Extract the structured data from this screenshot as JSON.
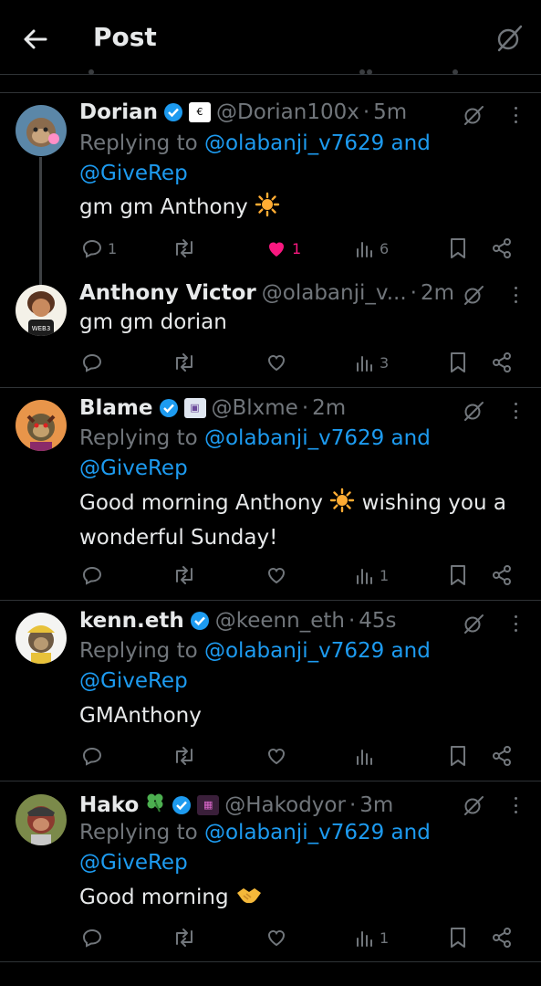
{
  "header": {
    "title": "Post"
  },
  "posts": [
    {
      "name": "Dorian",
      "handle": "@Dorian100x",
      "time": "5m",
      "reply_prefix": "Replying to",
      "reply_mention": "@olabanji_v7629 and",
      "reply_mention2": "@GiveRep",
      "text": "gm gm Anthony",
      "emoji": "☀️",
      "replies": "1",
      "likes": "1",
      "views": "6",
      "liked": true
    },
    {
      "name": "Anthony Victor",
      "handle": "@olabanji_v...",
      "time": "2m",
      "text": "gm gm dorian",
      "views": "3"
    },
    {
      "name": "Blame",
      "handle": "@Blxme",
      "time": "2m",
      "reply_prefix": "Replying to",
      "reply_mention": "@olabanji_v7629 and",
      "reply_mention2": "@GiveRep",
      "text_line1": "Good morning Anthony",
      "text_emoji": "☀️",
      "text_line1b": "wishing you a",
      "text_line2": "wonderful Sunday!",
      "views": "1"
    },
    {
      "name": "kenn.eth",
      "handle": "@keenn_eth",
      "time": "45s",
      "reply_prefix": "Replying to",
      "reply_mention": "@olabanji_v7629 and",
      "reply_mention2": "@GiveRep",
      "text": "GMAnthony"
    },
    {
      "name": "Hako",
      "name_emoji": "🍀",
      "handle": "@Hakodyor",
      "time": "3m",
      "reply_prefix": "Replying to",
      "reply_mention": "@olabanji_v7629 and",
      "reply_mention2": "@GiveRep",
      "text": "Good morning",
      "emoji": "🤝",
      "views": "1"
    }
  ],
  "icons": {
    "back": "arrow-left-icon",
    "grok": "grok-icon",
    "verified": "verified-badge-icon",
    "reply": "reply-icon",
    "retweet": "retweet-icon",
    "like": "heart-icon",
    "views": "views-icon",
    "bookmark": "bookmark-icon",
    "share": "share-icon",
    "more": "more-icon"
  },
  "colors": {
    "background": "#000000",
    "text": "#e7e9ea",
    "muted": "#71767b",
    "link": "#1d9bf0",
    "like_active": "#f91880",
    "verified": "#1d9bf0"
  }
}
